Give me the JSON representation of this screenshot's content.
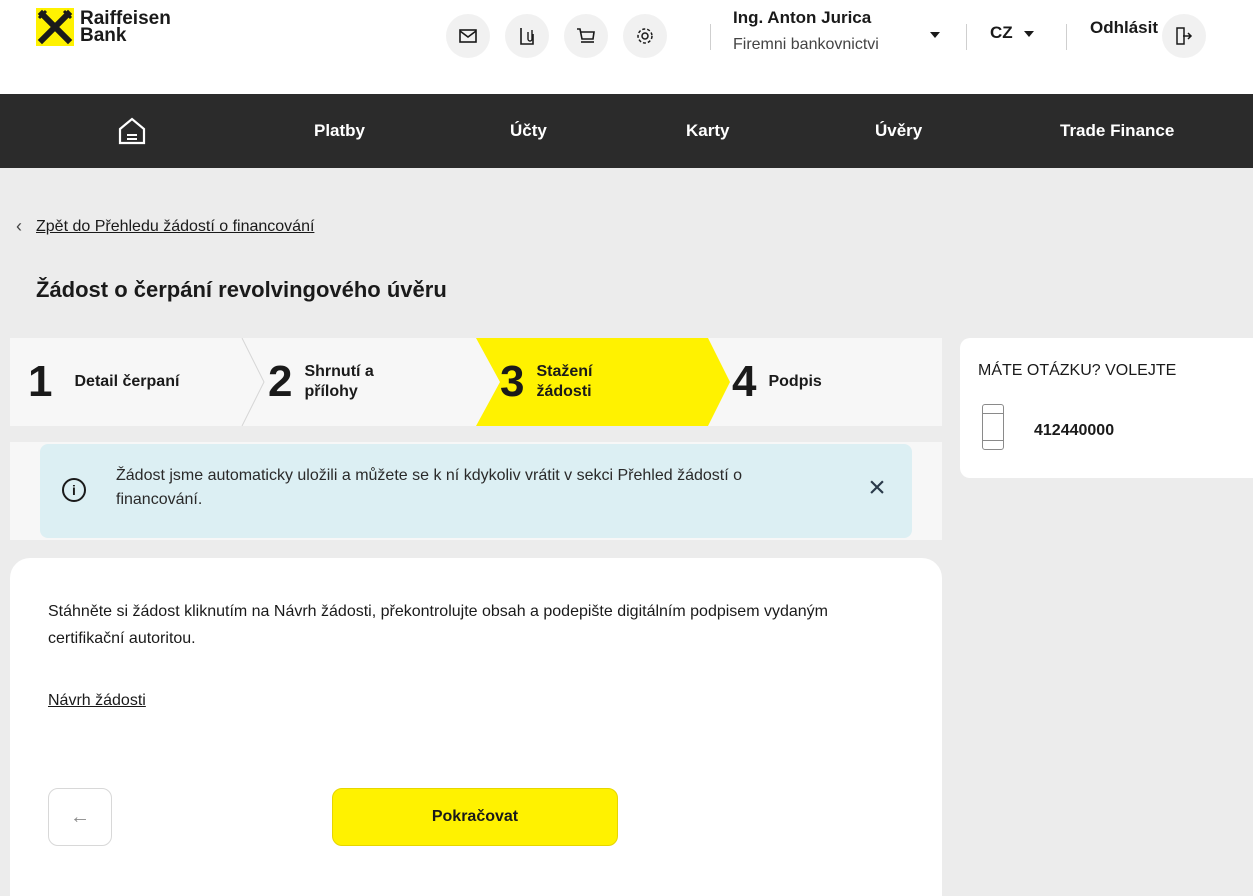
{
  "brand": {
    "line1": "Raiffeisen",
    "line2": "Bank",
    "accent": "#fff200"
  },
  "header": {
    "icons": [
      "mail-icon",
      "document-clip-icon",
      "cart-icon",
      "gear-icon"
    ],
    "user_name": "Ing. Anton Jurica",
    "user_context": "Firemni bankovnictvi",
    "language": "CZ",
    "logout_label": "Odhlásit"
  },
  "nav": {
    "home_icon": "home-icon",
    "items": [
      "Platby",
      "Účty",
      "Karty",
      "Úvěry",
      "Trade Finance"
    ]
  },
  "breadcrumb": {
    "back_label": "Zpět do Přehledu žádostí o financování"
  },
  "page_title": "Žádost o čerpání revolvingového úvěru",
  "steps": [
    {
      "number": "1",
      "label": "Detail čerpaní",
      "active": false
    },
    {
      "number": "2",
      "label_line1": "Shrnutí a",
      "label_line2": "přílohy",
      "active": false
    },
    {
      "number": "3",
      "label_line1": "Stažení",
      "label_line2": "žádosti",
      "active": true
    },
    {
      "number": "4",
      "label": "Podpis",
      "active": false
    }
  ],
  "banner": {
    "text": "Žádost jsme automaticky uložili a můžete se k ní kdykoliv vrátit v sekci  Přehled žádostí o financování.",
    "close_symbol": "×",
    "icon_symbol": "i"
  },
  "main": {
    "instructions": "Stáhněte si žádost kliknutím na Návrh žádosti, překontrolujte obsah a podepište digitálním podpisem vydaným certifikační autoritou.",
    "draft_link": "Návrh žádosti",
    "back_button_symbol": "←",
    "continue_label": "Pokračovat"
  },
  "contact": {
    "title": "MÁTE OTÁZKU? VOLEJTE",
    "phone": "412440000"
  }
}
